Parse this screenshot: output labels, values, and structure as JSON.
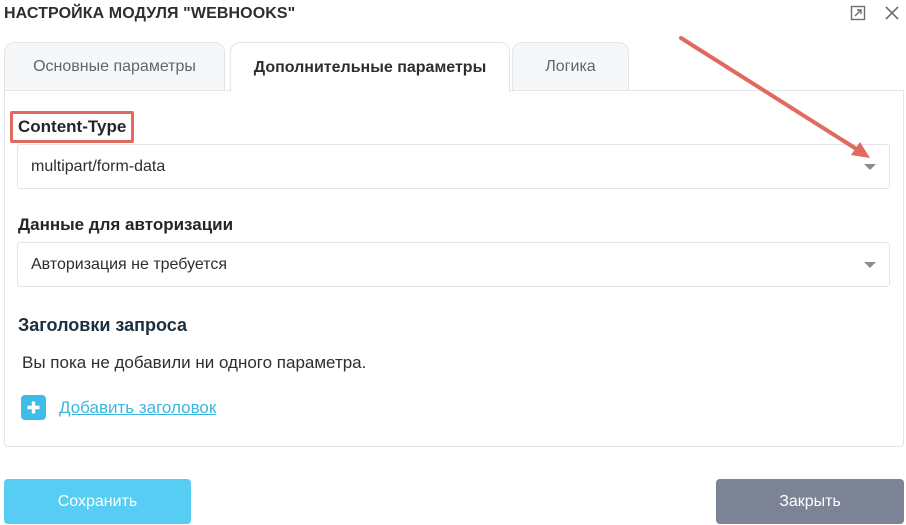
{
  "dialog": {
    "title": "НАСТРОЙКА МОДУЛЯ \"WEBHOOKS\"",
    "expand_icon": "expand-icon",
    "close_icon": "close-icon"
  },
  "tabs": [
    {
      "label": "Основные параметры",
      "active": false
    },
    {
      "label": "Дополнительные параметры",
      "active": true
    },
    {
      "label": "Логика",
      "active": false
    }
  ],
  "content_type": {
    "label": "Content-Type",
    "value": "multipart/form-data"
  },
  "auth": {
    "label": "Данные для авторизации",
    "value": "Авторизация не требуется"
  },
  "headers": {
    "title": "Заголовки запроса",
    "empty_text": "Вы пока не добавили ни одного параметра.",
    "add_label": "Добавить заголовок",
    "add_icon": "plus-icon"
  },
  "footer": {
    "save_label": "Сохранить",
    "close_label": "Закрыть"
  },
  "colors": {
    "accent": "#3dbbe9",
    "save_button": "#58cdf3",
    "close_button": "#7b8394",
    "annotation": "#e06a5e"
  }
}
